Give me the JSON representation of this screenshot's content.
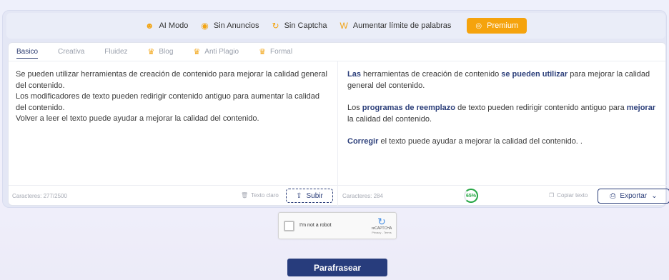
{
  "features": [
    {
      "icon": "robot-icon",
      "label": "AI Modo"
    },
    {
      "icon": "no-ads-icon",
      "label": "Sin Anuncios"
    },
    {
      "icon": "refresh-icon",
      "label": "Sin Captcha"
    },
    {
      "icon": "word-icon",
      "label": "Aumentar límite de palabras"
    }
  ],
  "premium_label": "Premium",
  "tabs": [
    {
      "label": "Basico",
      "premium": false
    },
    {
      "label": "Creativa",
      "premium": false
    },
    {
      "label": "Fluidez",
      "premium": false
    },
    {
      "label": "Blog",
      "premium": true
    },
    {
      "label": "Anti Plagio",
      "premium": true
    },
    {
      "label": "Formal",
      "premium": true
    }
  ],
  "input": {
    "lines": [
      "Se pueden utilizar herramientas de creación de contenido para mejorar la calidad general del contenido.",
      "Los modificadores de texto pueden redirigir contenido antiguo para aumentar la calidad del contenido.",
      "Volver a leer el texto puede ayudar a mejorar la calidad del contenido."
    ],
    "char_count": "Caracteres: 277/2500",
    "clear_label": "Texto claro",
    "upload_label": "Subir"
  },
  "output": {
    "p1": {
      "b1": "Las",
      "t1": " herramientas de creación de contenido ",
      "b2": "se pueden utilizar",
      "t2": " para mejorar la calidad general del contenido."
    },
    "p2": {
      "t0": "Los ",
      "b1": "programas de reemplazo",
      "t1": " de texto pueden redirigir contenido antiguo para ",
      "b2": "mejorar",
      "t2": " la calidad del contenido."
    },
    "p3": {
      "b1": "Corregir",
      "t1": " el texto puede ayudar a mejorar la calidad del contenido.   ."
    },
    "char_count": "Caracteres: 284",
    "score": "65%",
    "copy_label": "Copiar texto",
    "export_label": "Exportar"
  },
  "captcha": {
    "label": "I'm not a robot",
    "brand": "reCAPTCHA",
    "links": "Privacy - Terms"
  },
  "submit_label": "Parafrasear",
  "colors": {
    "accent": "#273c7c",
    "premium": "#f5a30d",
    "score": "#27a745"
  }
}
